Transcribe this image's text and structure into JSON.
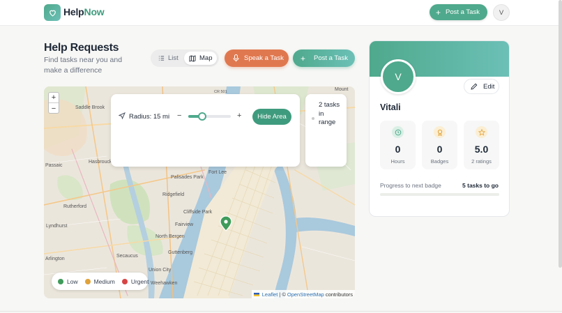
{
  "header": {
    "brand_part1": "Help",
    "brand_part2": "Now",
    "post_task_label": "Post a Task",
    "avatar_initial": "V"
  },
  "page": {
    "title": "Help Requests",
    "subtitle": "Find tasks near you and make a difference"
  },
  "view_toggle": {
    "list_label": "List",
    "map_label": "Map",
    "selected": "Map"
  },
  "actions": {
    "speak_label": "Speak a Task",
    "post_label": "Post a Task"
  },
  "map": {
    "zoom_in": "+",
    "zoom_out": "−",
    "radius_label": "Radius: 15 mi",
    "radius_value_fraction": 0.33,
    "minus_label": "−",
    "plus_label": "+",
    "hide_area_label": "Hide Area",
    "tasks_in_range": "2 tasks in range",
    "legend": [
      {
        "label": "Low",
        "color": "#3f9b5a"
      },
      {
        "label": "Medium",
        "color": "#e0a23a"
      },
      {
        "label": "Urgent",
        "color": "#d64545"
      }
    ],
    "attribution": {
      "leaflet": "Leaflet",
      "sep": "| ©",
      "osm": "OpenStreetMap",
      "contributors": "contributors"
    },
    "place_labels": [
      "Saddle Brook",
      "Passaic",
      "Hasbrouck Heights",
      "Rutherford",
      "Lyndhurst",
      "Arlington",
      "Secaucus",
      "Union City",
      "Weehawken",
      "Guttenberg",
      "North Bergen",
      "Fairview",
      "Cliffside Park",
      "Ridgefield",
      "Palisades Park",
      "Fort Lee",
      "Mount",
      "CR 501"
    ]
  },
  "profile": {
    "avatar_initial": "V",
    "edit_label": "Edit",
    "name": "Vitali",
    "stats": [
      {
        "value": "0",
        "label": "Hours",
        "icon": "clock-icon",
        "color": "#4fa98c"
      },
      {
        "value": "0",
        "label": "Badges",
        "icon": "award-icon",
        "color": "#e0a23a"
      },
      {
        "value": "5.0",
        "label": "2 ratings",
        "icon": "star-icon",
        "color": "#e0a23a"
      }
    ],
    "progress_label": "Progress to next badge",
    "progress_value": "5 tasks to go",
    "progress_fraction": 0
  }
}
